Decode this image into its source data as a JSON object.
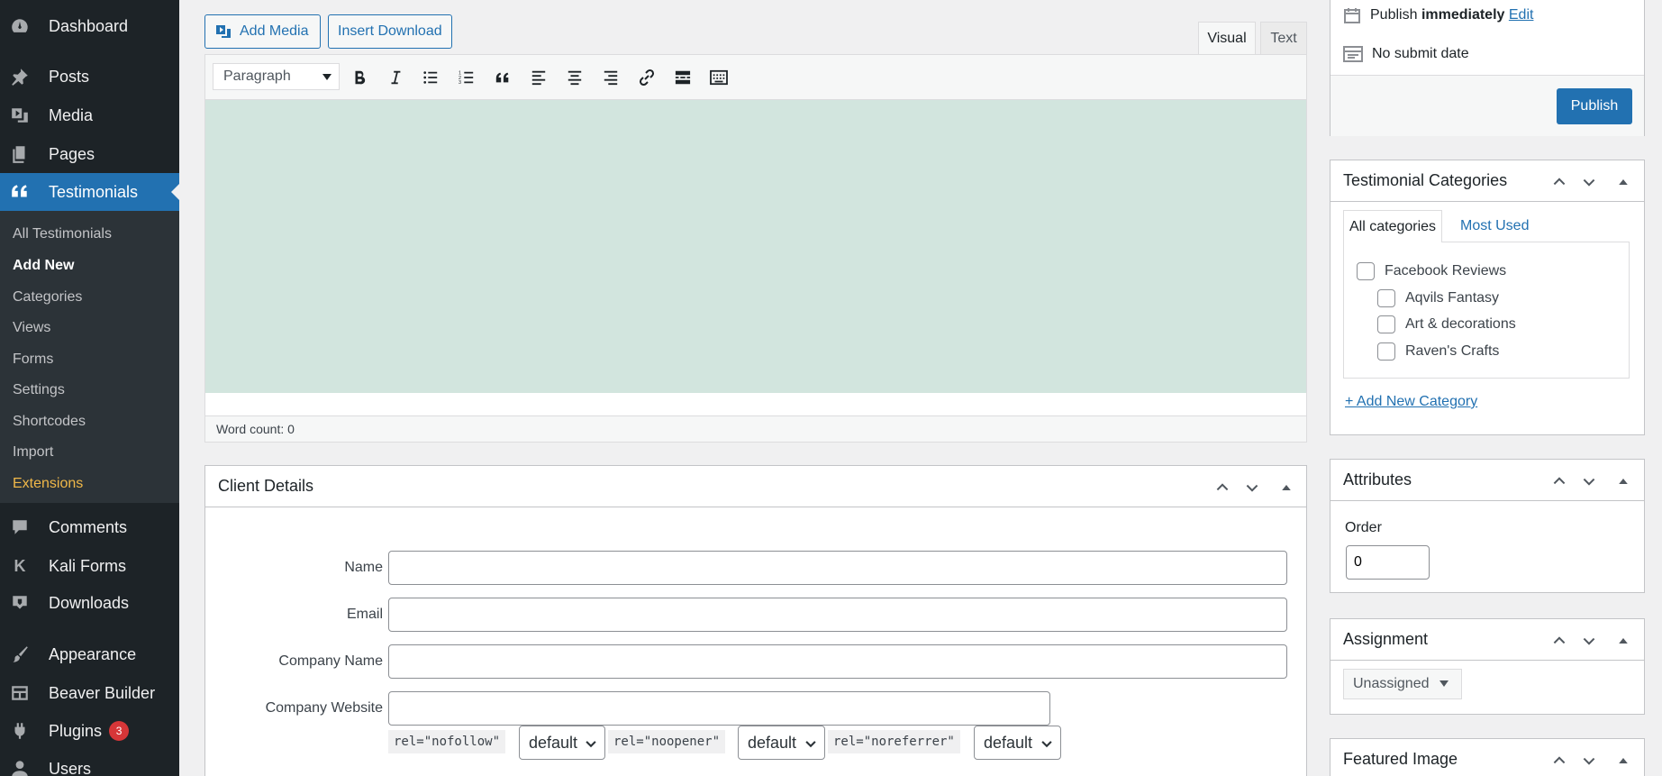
{
  "sidebar": {
    "items": [
      {
        "label": "Dashboard",
        "icon": "dashboard-icon"
      },
      {
        "label": "Posts",
        "icon": "pin-icon"
      },
      {
        "label": "Media",
        "icon": "media-icon"
      },
      {
        "label": "Pages",
        "icon": "pages-icon"
      },
      {
        "label": "Testimonials",
        "icon": "quote-icon"
      },
      {
        "label": "Comments",
        "icon": "comment-icon"
      },
      {
        "label": "Kali Forms",
        "icon": "k-icon"
      },
      {
        "label": "Downloads",
        "icon": "download-icon"
      },
      {
        "label": "Appearance",
        "icon": "brush-icon"
      },
      {
        "label": "Beaver Builder",
        "icon": "layout-icon"
      },
      {
        "label": "Plugins",
        "icon": "plug-icon",
        "badge": "3"
      },
      {
        "label": "Users",
        "icon": "user-icon"
      }
    ],
    "submenu": [
      "All Testimonials",
      "Add New",
      "Categories",
      "Views",
      "Forms",
      "Settings",
      "Shortcodes",
      "Import",
      "Extensions"
    ]
  },
  "editor": {
    "add_media": "Add Media",
    "insert_download": "Insert Download",
    "tab_visual": "Visual",
    "tab_text": "Text",
    "format": "Paragraph",
    "word_count": "Word count: 0"
  },
  "client_details": {
    "title": "Client Details",
    "name_label": "Name",
    "email_label": "Email",
    "company_label": "Company Name",
    "website_label": "Company Website",
    "rel_nofollow": "rel=\"nofollow\"",
    "rel_noopener": "rel=\"noopener\"",
    "rel_noreferrer": "rel=\"noreferrer\"",
    "default1": "default",
    "default2": "default",
    "default3": "default"
  },
  "publish": {
    "publish_prefix": "Publish",
    "publish_when": "immediately",
    "edit": "Edit",
    "no_submit": "No submit date",
    "button": "Publish"
  },
  "categories": {
    "title": "Testimonial Categories",
    "tab_all": "All categories",
    "tab_most": "Most Used",
    "items": [
      "Facebook Reviews",
      "Aqvils Fantasy",
      "Art & decorations",
      "Raven's Crafts"
    ],
    "add_new": "+ Add New Category"
  },
  "attributes": {
    "title": "Attributes",
    "order_label": "Order",
    "order_value": "0"
  },
  "assignment": {
    "title": "Assignment",
    "value": "Unassigned"
  },
  "featured": {
    "title": "Featured Image"
  }
}
